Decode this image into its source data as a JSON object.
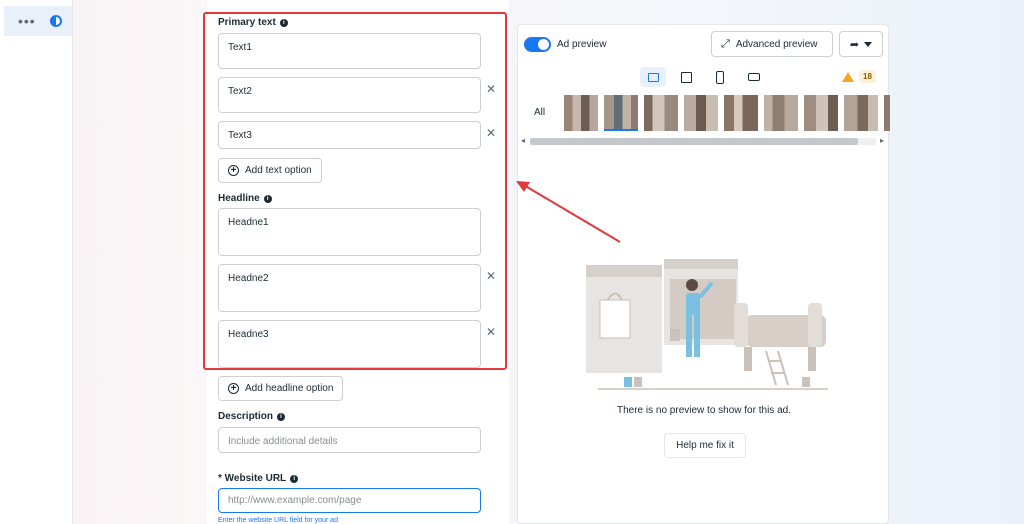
{
  "rail": {
    "more_icon": "more-dots-icon",
    "theme_icon": "half-circle-icon"
  },
  "form": {
    "primary_text": {
      "label": "Primary text",
      "values": [
        "Text1",
        "Text2",
        "Text3"
      ],
      "add_label": "Add text option"
    },
    "headline": {
      "label": "Headline",
      "values": [
        "Headne1",
        "Headne2",
        "Headne3"
      ],
      "add_label": "Add headline option"
    },
    "description": {
      "label": "Description",
      "placeholder": "Include additional details"
    },
    "website_url": {
      "label": "* Website URL",
      "placeholder": "http://www.example.com/page",
      "hint": "Enter the website URL field for your ad"
    }
  },
  "preview": {
    "toggle_label": "Ad preview",
    "toggle_on": true,
    "advanced_label": "Advanced preview",
    "warning_count": "18",
    "all_tab": "All",
    "empty_text": "There is no preview to show for this ad.",
    "fix_label": "Help me fix it"
  },
  "colors": {
    "accent": "#1877f2",
    "annotation": "#e0393e",
    "warning": "#f5a623"
  }
}
